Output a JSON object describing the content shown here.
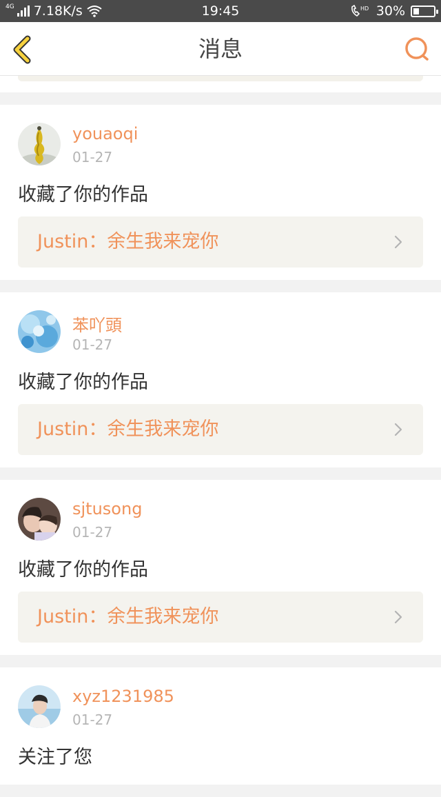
{
  "status_bar": {
    "network_label": "4G",
    "speed": "7.18K/s",
    "time": "19:45",
    "hd_label": "HD",
    "battery": "30%",
    "battery_level": 0.3
  },
  "header": {
    "title": "消息",
    "back_icon": "chevron-left-icon",
    "search_icon": "search-icon",
    "accent_color": "#f0925a"
  },
  "messages": [
    {
      "user": "youaoqi",
      "date": "01-27",
      "action": "收藏了你的作品",
      "reference": "Justin：余生我来宠你"
    },
    {
      "user": "苯吖頭",
      "date": "01-27",
      "action": "收藏了你的作品",
      "reference": "Justin：余生我来宠你"
    },
    {
      "user": "sjtusong",
      "date": "01-27",
      "action": "收藏了你的作品",
      "reference": "Justin：余生我来宠你"
    },
    {
      "user": "xyz1231985",
      "date": "01-27",
      "action": "关注了您"
    }
  ]
}
